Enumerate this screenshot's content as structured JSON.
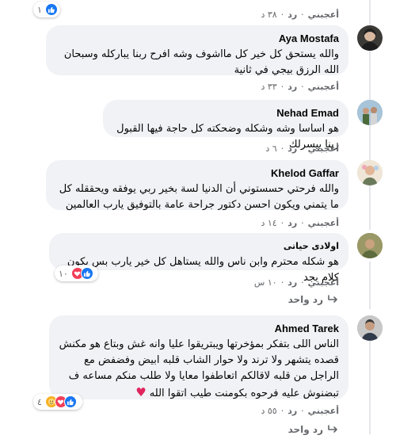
{
  "comments": [
    {
      "id": "c0",
      "meta": {
        "like": "أعجبني",
        "reply": "رد",
        "time": "٣٨ د"
      },
      "reactions": {
        "count": "١"
      }
    },
    {
      "id": "c1",
      "author": "Aya Mostafa",
      "text": "والله يستحق كل خير كل مااشوف وشه افرح ربنا يباركله وسبحان الله الرزق بيجي في ثانية",
      "meta": {
        "like": "أعجبني",
        "reply": "رد",
        "time": "٣٣ د"
      }
    },
    {
      "id": "c2",
      "author": "Nehad Emad",
      "text": "هو اساسا وشه وشكله وضحكته كل حاجة فيها القبول ربنا ييسرلك",
      "meta": {
        "like": "أعجبني",
        "reply": "رد",
        "time": "٦ د"
      }
    },
    {
      "id": "c3",
      "author": "Khelod Gaffar",
      "text": "والله فرحتي حسستوني أن الدنيا لسة بخير ربي يوفقه ويحققله كل ما يتمني ويكون احسن دكتور جراحة عامة بالتوفيق يارب العالمين",
      "meta": {
        "like": "أعجبني",
        "reply": "رد",
        "time": "١٤ د"
      }
    },
    {
      "id": "c4",
      "author": "اولادى حياتى",
      "text": "هو شكله محترم وابن ناس والله يستاهل كل خير يارب بس يكون كلام بجد",
      "meta": {
        "like": "أعجبني",
        "reply": "رد",
        "time": "١٠ س"
      },
      "reactions": {
        "count": "١٠"
      },
      "replies_label": "رد واحد"
    },
    {
      "id": "c5",
      "author": "Ahmed Tarek",
      "text": "الناس اللى بتفكر بمؤخرتها ويبتريقوا عليا وانه غش وبتاع هو مكنش قصده يتشهر ولا ترند ولا حوار الشاب قلبه ابيض وفضفض مع الراجل من قلبه لاقالكم اتعاطفوا معايا ولا طلب منكم مساعه ف تبضنوش عليه فرحوه بكومنت طيب اتقوا الله",
      "emoji": "♥",
      "meta": {
        "like": "أعجبني",
        "reply": "رد",
        "time": "٥٥ د"
      },
      "reactions": {
        "count": "٤"
      },
      "replies_label": "رد واحد"
    }
  ],
  "colors": {
    "bubble": "#f0f2f5",
    "meta_text": "#65676b",
    "like_blue": "#1877f2",
    "love_red": "#f33e58",
    "care_yellow": "#f7b125",
    "heart_emoji": "#e0245e"
  },
  "icons": [
    "like-icon",
    "love-icon",
    "care-icon",
    "reply-arrow-icon",
    "heart-emoji-icon"
  ]
}
